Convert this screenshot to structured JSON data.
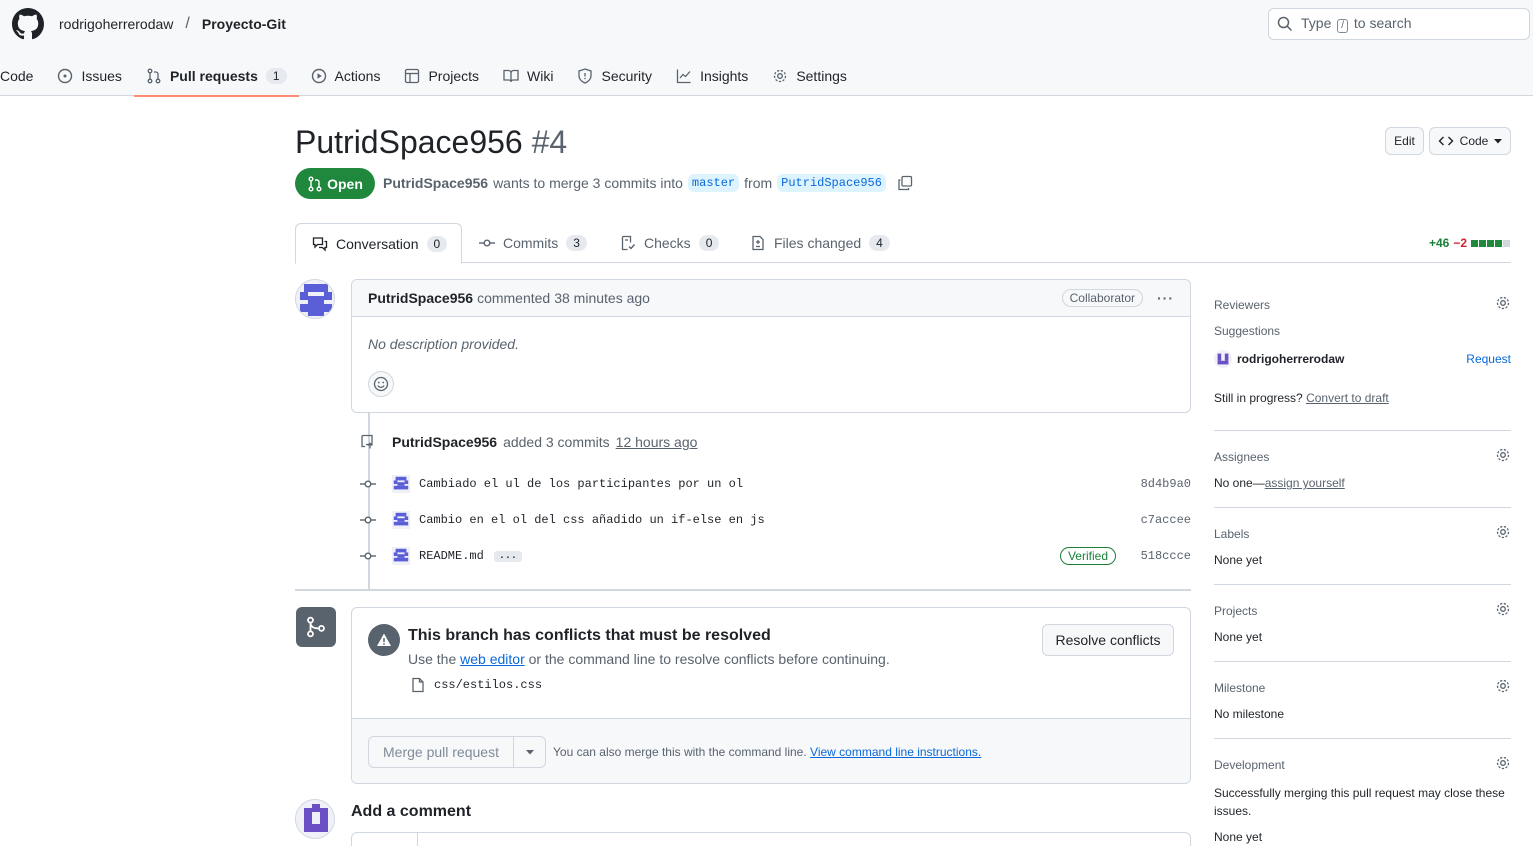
{
  "header": {
    "owner": "rodrigoherrerodaw",
    "separator": "/",
    "repo": "Proyecto-Git",
    "search": {
      "prefix": "Type",
      "key": "/",
      "suffix": "to search"
    }
  },
  "nav": {
    "code": "Code",
    "issues": "Issues",
    "pull_requests": "Pull requests",
    "pull_requests_count": "1",
    "actions": "Actions",
    "projects": "Projects",
    "wiki": "Wiki",
    "security": "Security",
    "insights": "Insights",
    "settings": "Settings"
  },
  "pr": {
    "title": "PutridSpace956",
    "number": "#4",
    "edit_label": "Edit",
    "code_label": "Code",
    "state": "Open",
    "author": "PutridSpace956",
    "merge_text": "wants to merge 3 commits into",
    "base": "master",
    "from_text": "from",
    "head": "PutridSpace956"
  },
  "tabs": {
    "conversation": "Conversation",
    "conversation_count": "0",
    "commits": "Commits",
    "commits_count": "3",
    "checks": "Checks",
    "checks_count": "0",
    "files": "Files changed",
    "files_count": "4",
    "additions": "+46",
    "deletions": "−2",
    "diff_bar": {
      "added": 4,
      "neutral": 1
    }
  },
  "comment": {
    "author": "PutridSpace956",
    "action": "commented",
    "time": "38 minutes ago",
    "badge": "Collaborator",
    "menu": "···",
    "body": "No description provided."
  },
  "timeline": {
    "author": "PutridSpace956",
    "action": "added 3 commits",
    "time": "12 hours ago",
    "commits": [
      {
        "message": "Cambiado el ul de los participantes por un ol",
        "sha": "8d4b9a0"
      },
      {
        "message": "Cambio en el ol del css añadido un if-else en js",
        "sha": "c7accee"
      },
      {
        "message": "README.md",
        "sha": "518ccce",
        "verified": "Verified",
        "more": "..."
      }
    ]
  },
  "merge": {
    "heading": "This branch has conflicts that must be resolved",
    "sub_pre": "Use the",
    "sub_link": "web editor",
    "sub_post": "or the command line to resolve conflicts before continuing.",
    "file": "css/estilos.css",
    "resolve_label": "Resolve conflicts",
    "merge_label": "Merge pull request",
    "note": "You can also merge this with the command line.",
    "note_link": "View command line instructions."
  },
  "add_comment": {
    "title": "Add a comment"
  },
  "sidebar": {
    "reviewers": "Reviewers",
    "suggestions": "Suggestions",
    "suggested_user": "rodrigoherrerodaw",
    "request": "Request",
    "in_progress": "Still in progress?",
    "convert": "Convert to draft",
    "assignees": "Assignees",
    "assignees_none": "No one—",
    "assign_yourself": "assign yourself",
    "labels": "Labels",
    "labels_value": "None yet",
    "projects": "Projects",
    "projects_value": "None yet",
    "milestone": "Milestone",
    "milestone_value": "No milestone",
    "development": "Development",
    "development_text": "Successfully merging this pull request may close these issues.",
    "development_value": "None yet"
  },
  "colors": {
    "accent": "#1f883d",
    "link": "#0969da",
    "tab_underline": "#fd8c73",
    "avatar": "#5a5fd8"
  }
}
